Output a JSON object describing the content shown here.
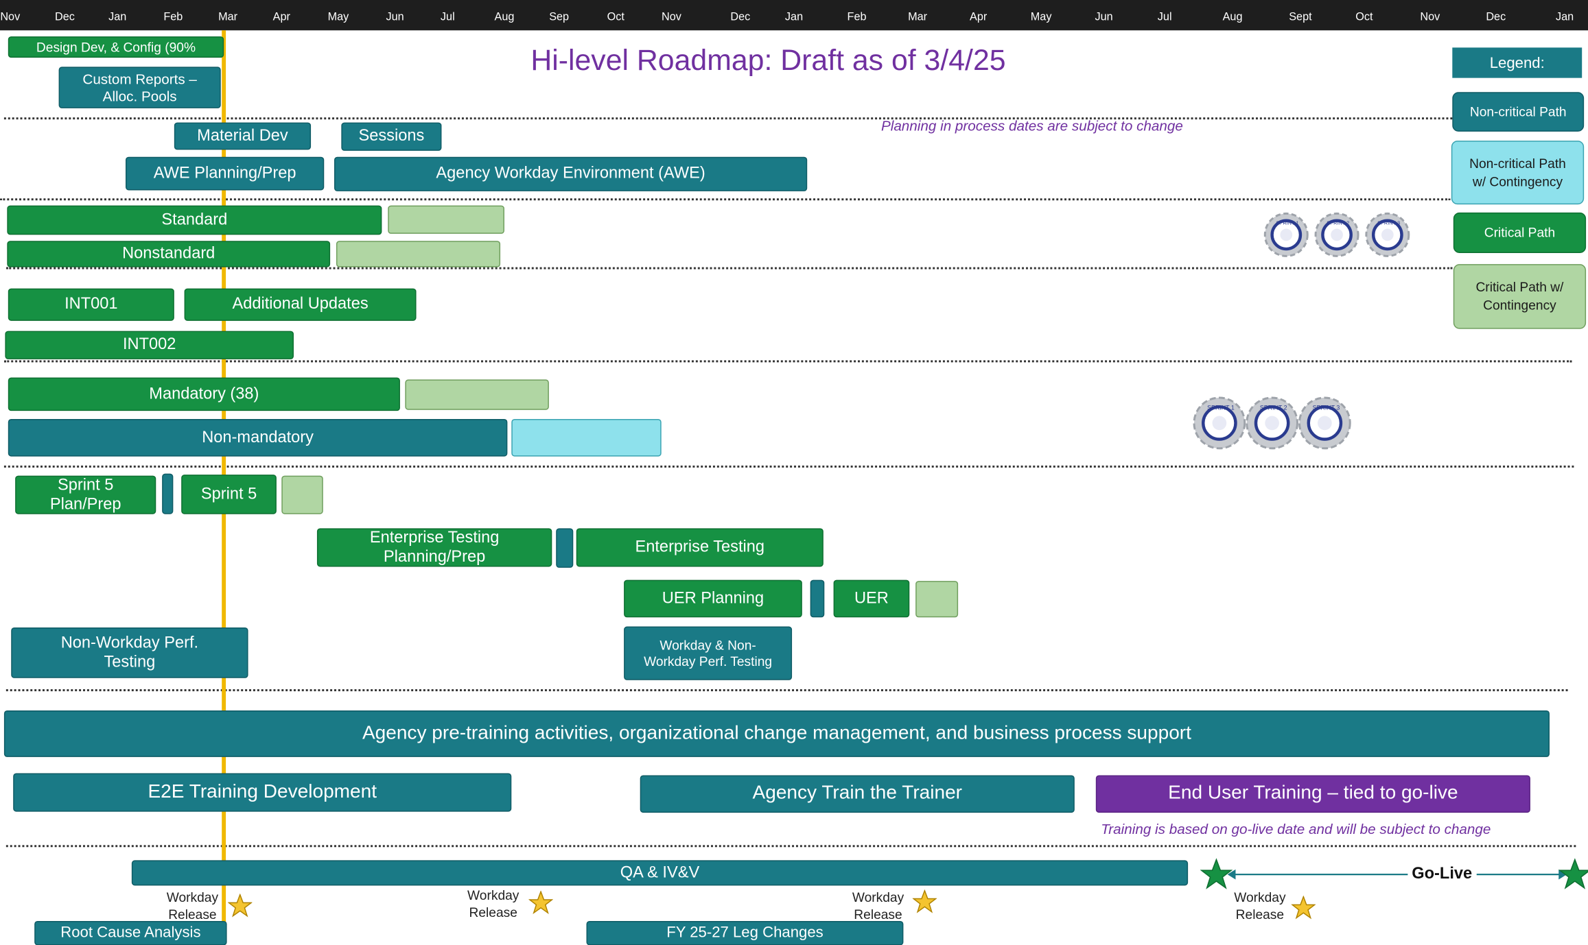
{
  "timeline": {
    "months": [
      "Nov",
      "Dec",
      "Jan",
      "Feb",
      "Mar",
      "Apr",
      "May",
      "Jun",
      "Jul",
      "Aug",
      "Sep",
      "Oct",
      "Nov",
      "Dec",
      "Jan",
      "Feb",
      "Mar",
      "Apr",
      "May",
      "Jun",
      "Jul",
      "Aug",
      "Sept",
      "Oct",
      "Nov",
      "Dec",
      "Jan"
    ]
  },
  "title": "Hi-level Roadmap: Draft as of 3/4/25",
  "notes": {
    "planning": "Planning in process dates are subject to change",
    "training": "Training is based on go-live date and will be subject to change"
  },
  "bars": {
    "design_dev": "Design Dev, & Config (90%",
    "custom_reports": "Custom Reports – Alloc. Pools",
    "material_dev": "Material Dev",
    "sessions": "Sessions",
    "awe_planning": "AWE Planning/Prep",
    "awe": "Agency Workday Environment (AWE)",
    "standard": "Standard",
    "nonstandard": "Nonstandard",
    "int001": "INT001",
    "additional_updates": "Additional Updates",
    "int002": "INT002",
    "mandatory": "Mandatory (38)",
    "non_mandatory": "Non-mandatory",
    "sprint5_plan": "Sprint 5 Plan/Prep",
    "sprint5": "Sprint 5",
    "ent_testing_plan": "Enterprise Testing Planning/Prep",
    "ent_testing": "Enterprise Testing",
    "uer_planning": "UER Planning",
    "uer": "UER",
    "nonworkday_perf": "Non-Workday Perf. Testing",
    "workday_perf": "Workday & Non-Workday Perf. Testing",
    "agency_pretraining": "Agency pre-training activities, organizational change management, and business process support",
    "e2e_training": "E2E Training Development",
    "train_trainer": "Agency Train the Trainer",
    "end_user_training": "End User Training – tied to go-live",
    "qa": "QA & IV&V",
    "root_cause": "Root Cause Analysis",
    "fy_leg": "FY 25-27 Leg Changes"
  },
  "releases": [
    "Workday Release",
    "Workday Release",
    "Workday Release",
    "Workday Release"
  ],
  "golive": "Go-Live",
  "sprint_gears": [
    "SPRINT 1",
    "SPRINT 2",
    "SPRINT 3"
  ],
  "legend": {
    "header": "Legend:",
    "items": [
      "Non-critical Path",
      "Non-critical Path w/ Contingency",
      "Critical Path",
      "Critical Path w/ Contingency"
    ]
  },
  "colors": {
    "non_critical": "#1a7a86",
    "non_critical_contingency": "#8ee1ec",
    "critical": "#169143",
    "critical_contingency": "#b0d6a3",
    "training_highlight": "#7030a0",
    "today_line": "#f0b800"
  }
}
